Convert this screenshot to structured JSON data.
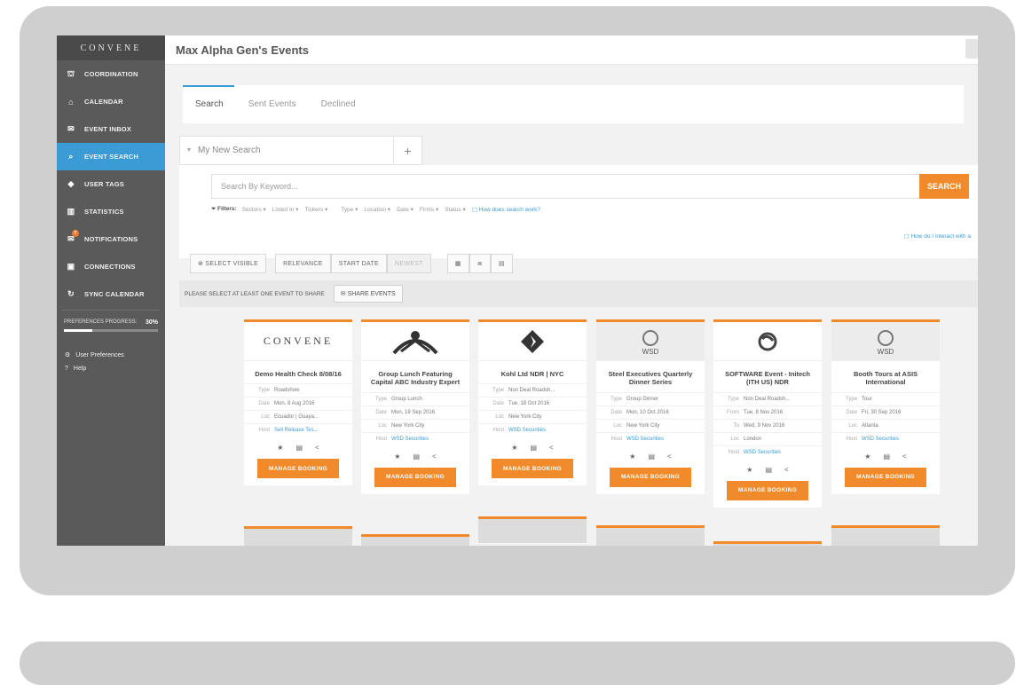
{
  "sidebar": {
    "logo": "CONVENE",
    "items": [
      {
        "icon": "sitemap-icon",
        "glyph": "⛫",
        "label": "COORDINATION"
      },
      {
        "icon": "home-icon",
        "glyph": "⌂",
        "label": "CALENDAR"
      },
      {
        "icon": "chat-icon",
        "glyph": "✉",
        "label": "EVENT INBOX"
      },
      {
        "icon": "search-icon",
        "glyph": "⌕",
        "label": "EVENT SEARCH"
      },
      {
        "icon": "tag-icon",
        "glyph": "◆",
        "label": "USER TAGS"
      },
      {
        "icon": "bar-chart-icon",
        "glyph": "▥",
        "label": "STATISTICS"
      },
      {
        "icon": "envelope-icon",
        "glyph": "✉",
        "label": "NOTIFICATIONS",
        "badge": "7"
      },
      {
        "icon": "connections-icon",
        "glyph": "▣",
        "label": "CONNECTIONS"
      },
      {
        "icon": "sync-icon",
        "glyph": "↻",
        "label": "SYNC CALENDAR"
      }
    ],
    "progress_label": "PREFERENCES PROGRESS:",
    "progress_value": "30%",
    "progress_fraction": 0.3,
    "user_preferences": "User Preferences",
    "help": "Help"
  },
  "header": {
    "title": "Max Alpha Gen's Events"
  },
  "tabs": [
    "Search",
    "Sent Events",
    "Declined"
  ],
  "search": {
    "tab_label": "My New Search",
    "placeholder": "Search By Keyword...",
    "button": "SEARCH",
    "filters_label": "Filters:",
    "filters": [
      "Sectors",
      "Listed In",
      "Tickers",
      "Type",
      "Location",
      "Date",
      "Firms",
      "Status"
    ],
    "help_link": "How does search work?",
    "interact_link": "How do I interact with a"
  },
  "toolbar": {
    "select_visible": "SELECT VISIBLE",
    "sort": [
      "RELEVANCE",
      "START DATE",
      "NEWEST"
    ]
  },
  "share": {
    "prompt": "PLEASE SELECT AT LEAST ONE EVENT TO SHARE",
    "button": "SHARE EVENTS"
  },
  "cards": [
    {
      "logo": "CONVENE",
      "title": "Demo Health Check 8/08/16",
      "rows": [
        {
          "k": "Type",
          "v": "Roadshow"
        },
        {
          "k": "Date",
          "v": "Mon, 8 Aug 2016"
        },
        {
          "k": "Loc",
          "v": "Ecuador | Guaya..."
        },
        {
          "k": "Host",
          "v": "Sell Release Tes...",
          "link": true
        }
      ],
      "action": "MANAGE BOOKING"
    },
    {
      "logo": "",
      "title": "Group Lunch Featuring Capital ABC Industry Expert",
      "rows": [
        {
          "k": "Type",
          "v": "Group Lunch"
        },
        {
          "k": "Date",
          "v": "Mon, 19 Sep 2016"
        },
        {
          "k": "Loc",
          "v": "New York City"
        },
        {
          "k": "Host",
          "v": "WSD Securities",
          "link": true
        }
      ],
      "action": "MANAGE BOOKING"
    },
    {
      "logo": "",
      "title": "Kohl Ltd NDR | NYC",
      "rows": [
        {
          "k": "Type",
          "v": "Non Deal Roadsh..."
        },
        {
          "k": "Date",
          "v": "Tue, 18 Oct 2016"
        },
        {
          "k": "Loc",
          "v": "New York City"
        },
        {
          "k": "Host",
          "v": "WSD Securities",
          "link": true
        }
      ],
      "action": "MANAGE BOOKING"
    },
    {
      "logo": "WSD",
      "title": "Steel Executives Quarterly Dinner Series",
      "rows": [
        {
          "k": "Type",
          "v": "Group Dinner"
        },
        {
          "k": "Date",
          "v": "Mon, 10 Oct 2016"
        },
        {
          "k": "Loc",
          "v": "New York City"
        },
        {
          "k": "Host",
          "v": "WSD Securities",
          "link": true
        }
      ],
      "action": "MANAGE BOOKING"
    },
    {
      "logo": "",
      "title": "SOFTWARE Event - Initech (ITH US) NDR",
      "rows": [
        {
          "k": "Type",
          "v": "Non Deal Roadsh..."
        },
        {
          "k": "From",
          "v": "Tue, 8 Nov 2016"
        },
        {
          "k": "To",
          "v": "Wed, 9 Nov 2016"
        },
        {
          "k": "Loc",
          "v": "London"
        },
        {
          "k": "Host",
          "v": "WSD Securities",
          "link": true
        }
      ],
      "action": "MANAGE BOOKING"
    },
    {
      "logo": "WSD",
      "title": "Booth Tours at ASIS International",
      "rows": [
        {
          "k": "Type",
          "v": "Tour"
        },
        {
          "k": "Date",
          "v": "Fri, 30 Sep 2016"
        },
        {
          "k": "Loc",
          "v": "Atlanta"
        },
        {
          "k": "Host",
          "v": "WSD Securities",
          "link": true
        }
      ],
      "action": "MANAGE BOOKING"
    }
  ],
  "colors": {
    "accent": "#f08a2a",
    "active_nav": "#3a9bd5",
    "sidebar": "#5a5a5a"
  }
}
